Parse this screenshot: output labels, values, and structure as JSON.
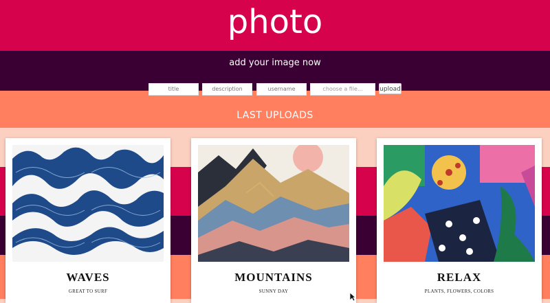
{
  "header": {
    "title": "photo"
  },
  "subheader": {
    "text": "add your image now"
  },
  "form": {
    "title_placeholder": "title",
    "description_placeholder": "description",
    "username_placeholder": "username",
    "file_placeholder": "choose a file...",
    "upload_label": "upload"
  },
  "section": {
    "title": "LAST UPLOADS"
  },
  "cards": [
    {
      "title": "WAVES",
      "caption": "GREAT TO SURF"
    },
    {
      "title": "MOUNTAINS",
      "caption": "SUNNY DAY"
    },
    {
      "title": "RELAX",
      "caption": "PLANTS, FLOWERS, COLORS"
    }
  ],
  "colors": {
    "header": "#d6034c",
    "subheader": "#3b0033",
    "form_band": "#ff7f5f",
    "background": "#fcd0c0"
  }
}
